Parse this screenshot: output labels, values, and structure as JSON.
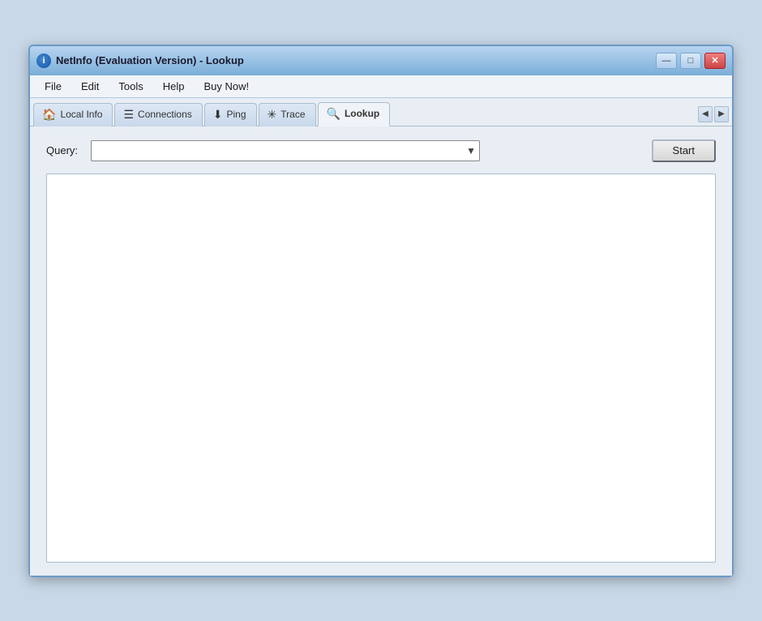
{
  "window": {
    "title": "NetInfo (Evaluation Version) - Lookup",
    "icon_label": "i"
  },
  "titlebar_buttons": {
    "minimize": "—",
    "maximize": "□",
    "close": "✕"
  },
  "menubar": {
    "items": [
      "File",
      "Edit",
      "Tools",
      "Help",
      "Buy Now!"
    ]
  },
  "tabs": [
    {
      "id": "local-info",
      "label": "Local Info",
      "icon": "🏠",
      "active": false
    },
    {
      "id": "connections",
      "label": "Connections",
      "icon": "≡",
      "active": false
    },
    {
      "id": "ping",
      "label": "Ping",
      "icon": "⬇",
      "active": false
    },
    {
      "id": "trace",
      "label": "Trace",
      "icon": "✳",
      "active": false
    },
    {
      "id": "lookup",
      "label": "Lookup",
      "icon": "🔍",
      "active": true
    }
  ],
  "tab_scroll": {
    "prev": "◀",
    "next": "▶"
  },
  "content": {
    "query_label": "Query:",
    "query_placeholder": "",
    "start_button": "Start"
  }
}
